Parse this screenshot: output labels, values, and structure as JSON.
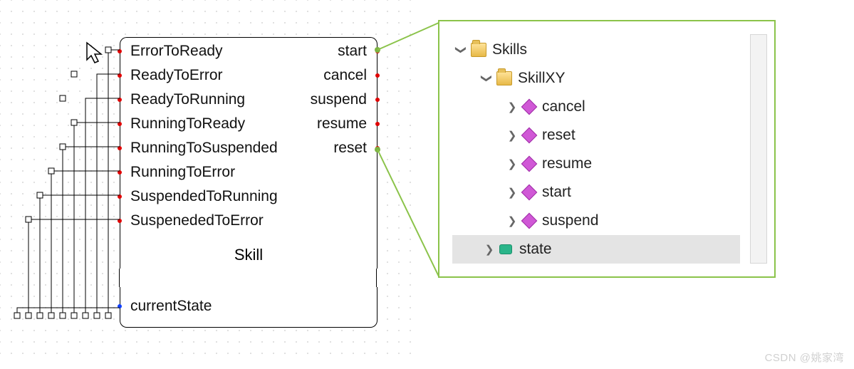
{
  "block": {
    "title": "Skill",
    "inputs": [
      "ErrorToReady",
      "ReadyToError",
      "ReadyToRunning",
      "RunningToReady",
      "RunningToSuspended",
      "RunningToError",
      "SuspendedToRunning",
      "SuspenededToError"
    ],
    "outputs": [
      "start",
      "cancel",
      "suspend",
      "resume",
      "reset"
    ],
    "bottom_port": "currentState"
  },
  "tree": {
    "root": {
      "label": "Skills"
    },
    "child": {
      "label": "SkillXY"
    },
    "methods": [
      "cancel",
      "reset",
      "resume",
      "start",
      "suspend"
    ],
    "variable": "state"
  },
  "watermark": "CSDN @姚家湾"
}
